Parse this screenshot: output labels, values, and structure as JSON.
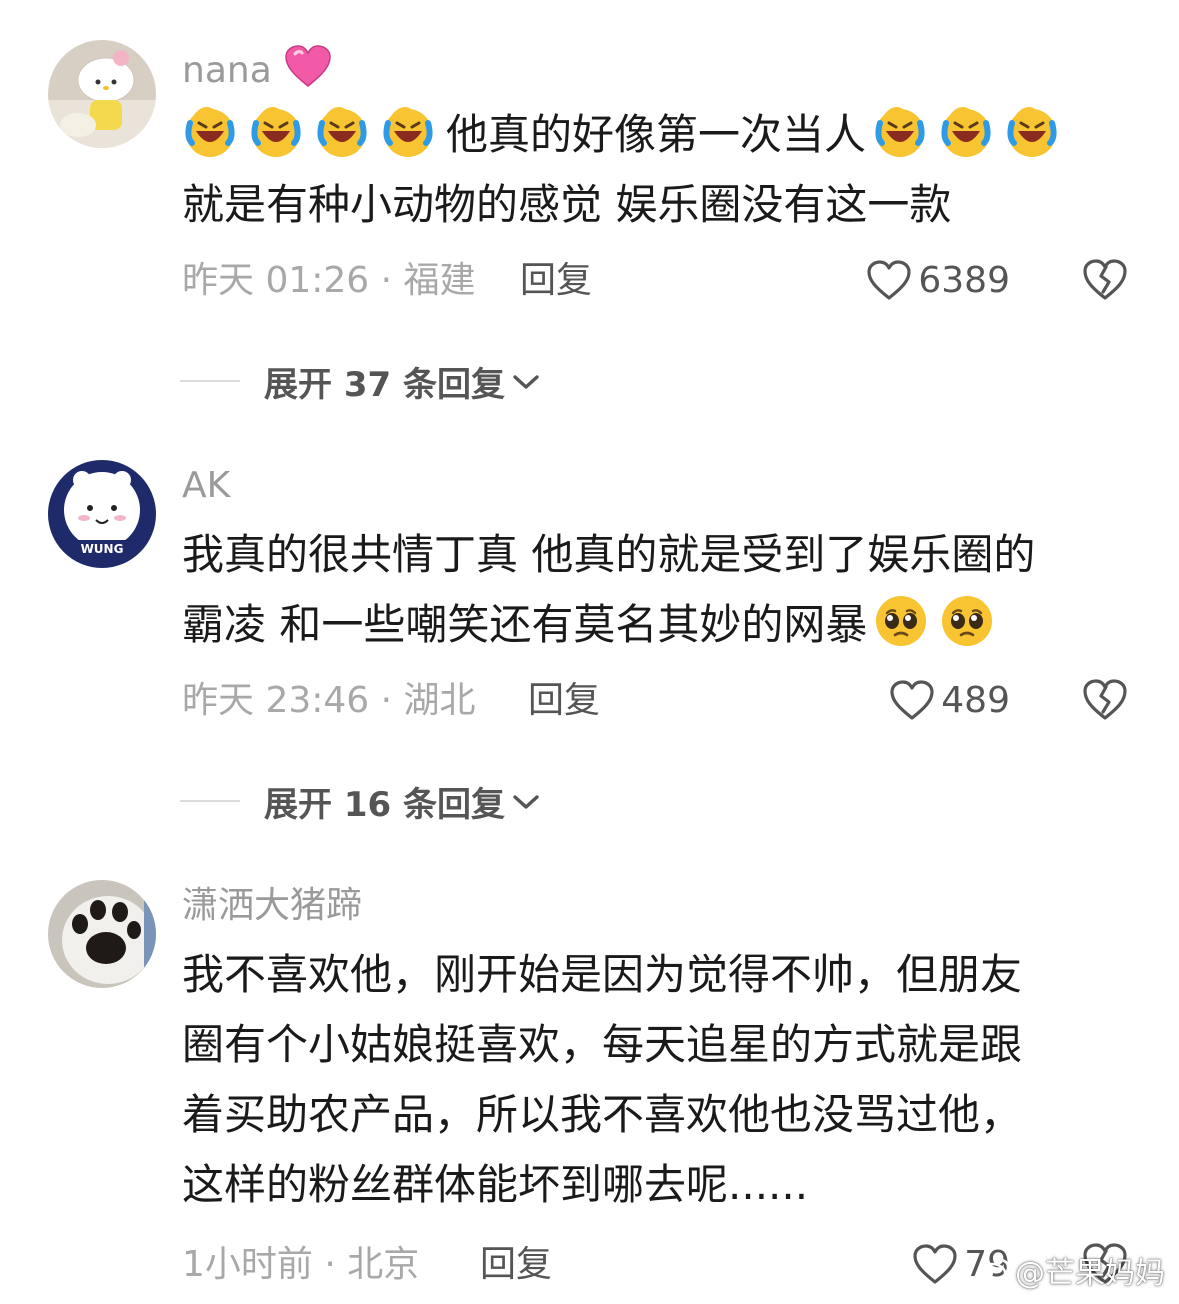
{
  "comments": [
    {
      "username": "nana",
      "username_emoji": "pink-heart-icon",
      "lines": [
        {
          "pre_emoji_count": 4,
          "text": "他真的好像第一次当人",
          "post_emoji_count": 3,
          "emoji": "laughing-crying-icon"
        },
        {
          "text": "就是有种小动物的感觉  娱乐圈没有这一款"
        }
      ],
      "time": "昨天 01:26 · 福建",
      "reply_label": "回复",
      "likes": "6389",
      "expand_label": "展开 37 条回复"
    },
    {
      "username": "AK",
      "lines": [
        {
          "text": "我真的很共情丁真 他真的就是受到了娱乐圈的"
        },
        {
          "text": "霸凌 和一些嘲笑还有莫名其妙的网暴",
          "post_emoji_count": 2,
          "emoji": "pleading-face-icon"
        }
      ],
      "time": "昨天 23:46 · 湖北",
      "reply_label": "回复",
      "likes": "489",
      "expand_label": "展开 16 条回复"
    },
    {
      "username": "潇洒大猪蹄",
      "lines": [
        {
          "text": "我不喜欢他，刚开始是因为觉得不帅，但朋友"
        },
        {
          "text": "圈有个小姑娘挺喜欢，每天追星的方式就是跟"
        },
        {
          "text": "着买助农产品，所以我不喜欢他也没骂过他，"
        },
        {
          "text": "这样的粉丝群体能坏到哪去呢......"
        }
      ],
      "time": "1小时前 · 北京",
      "reply_label": "回复",
      "likes": "79"
    }
  ],
  "watermark": "@芒果妈妈",
  "colors": {
    "username": "#9a9a9a",
    "body_text": "#1a1a1a",
    "meta": "#a8a8a8",
    "action": "#555555"
  }
}
